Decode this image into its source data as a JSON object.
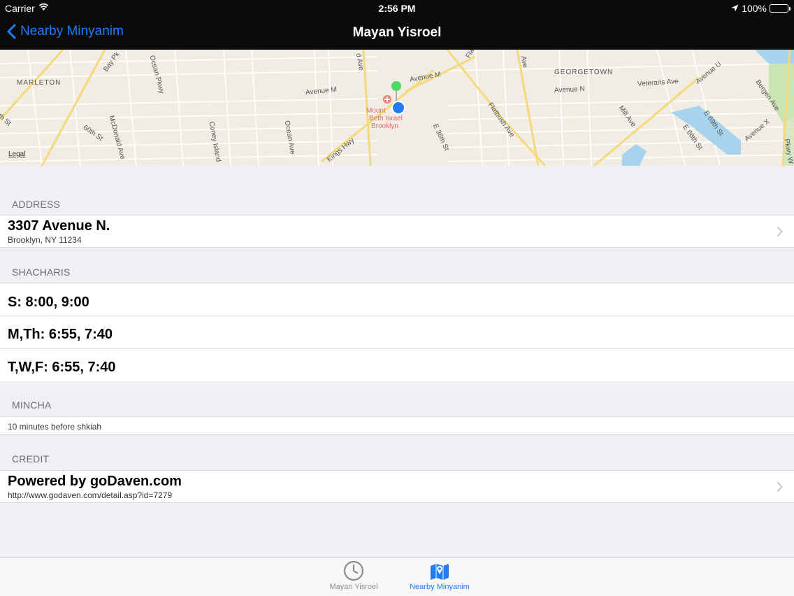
{
  "status_bar": {
    "carrier": "Carrier",
    "time": "2:56 PM",
    "battery": "100%"
  },
  "nav": {
    "back_label": "Nearby Minyanim",
    "title": "Mayan Yisroel"
  },
  "map": {
    "legal": "Legal",
    "labels": {
      "marleton": "MARLETON",
      "georgetown": "GEORGETOWN",
      "avenue_m": "Avenue M",
      "avenue_m2": "Avenue M",
      "avenue_n": "Avenue N",
      "veterans_ave": "Veterans Ave",
      "avenue_u": "Avenue U",
      "bergen_ave": "Bergen Ave",
      "avenue_x": "Avenue X",
      "e69th": "E 69th St",
      "e66th": "E 66th St",
      "mill_ave": "Mill Ave",
      "flatbush": "Flatbush Ave",
      "e36th": "E 36th St",
      "kings_hwy": "Kings Hwy",
      "ocean_ave": "Ocean Ave",
      "coney_island": "Coney Island",
      "mcdonald": "McDonald Ave",
      "sixtieth": "60th St",
      "ocean_pkwy": "Ocean Pkwy",
      "bay_pkwy": "Bay Pk",
      "th_st": "th St",
      "d_ave": "d Ave",
      "ave": "Ave",
      "fla": "Fla",
      "pkwy_w": "Pkwy W",
      "hospital_1": "Mount",
      "hospital_2": "Beth Israel",
      "hospital_3": "Brooklyn"
    },
    "colors": {
      "road_major": "#f5d97a",
      "road_minor": "#ffffff",
      "water": "#a7d3ec",
      "park": "#c9e5b3",
      "pin_green": "#4cd964",
      "user_blue": "#1f7cf4"
    }
  },
  "address": {
    "header": "ADDRESS",
    "street": "3307 Avenue N.",
    "city": "Brooklyn, NY 11234"
  },
  "shacharis": {
    "header": "SHACHARIS",
    "rows": [
      "S: 8:00, 9:00",
      "M,Th: 6:55, 7:40",
      "T,W,F: 6:55, 7:40"
    ]
  },
  "mincha": {
    "header": "MINCHA",
    "text": "10 minutes before shkiah"
  },
  "credit": {
    "header": "CREDIT",
    "title": "Powered by goDaven.com",
    "url": "http://www.godaven.com/detail.asp?id=7279"
  },
  "tab_bar": {
    "tabs": [
      {
        "label": "Mayan Yisroel",
        "icon": "clock-icon",
        "active": false
      },
      {
        "label": "Nearby Minyanim",
        "icon": "map-icon",
        "active": true
      }
    ],
    "active_color": "#1f7cf4",
    "inactive_color": "#8e8e93"
  }
}
